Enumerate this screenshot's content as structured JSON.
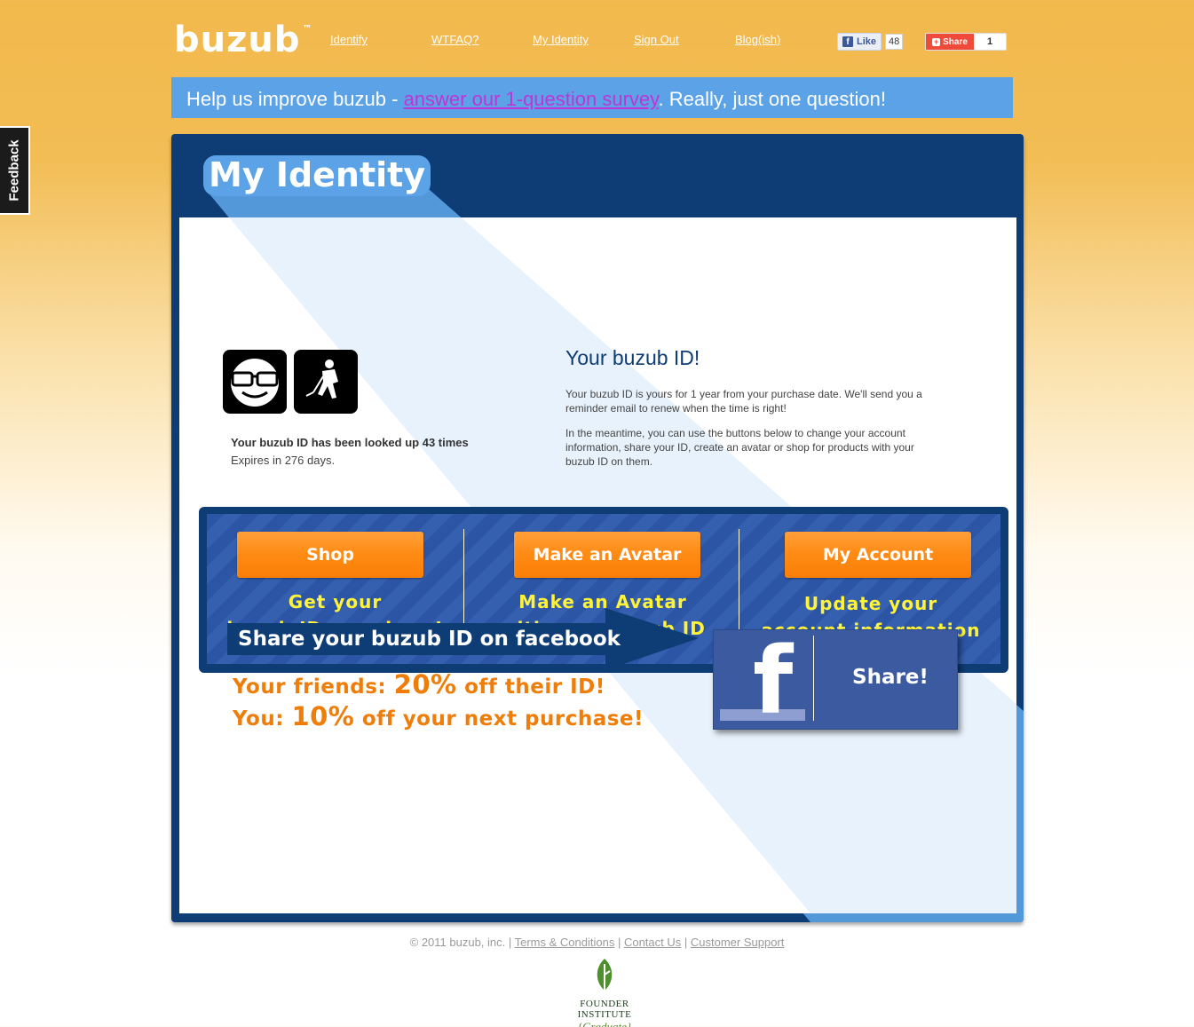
{
  "header": {
    "logo": "buzub",
    "logo_tm": "™",
    "nav": [
      "Identify",
      "WTFAQ?",
      "My Identity",
      "Sign Out",
      "Blog(ish)"
    ],
    "fb_like_label": "Like",
    "fb_like_count": "48",
    "share_label": "Share",
    "share_count": "1"
  },
  "survey": {
    "prefix": "Help us improve buzub - ",
    "link": "answer our 1-question survey",
    "suffix": ". Really, just one question!"
  },
  "feedback_tab": "Feedback",
  "page_title": "My Identity",
  "identity": {
    "lookups": "Your buzub ID has been looked up 43 times",
    "expires": "Expires in 276 days."
  },
  "buzub_id_info": {
    "title": "Your buzub ID!",
    "p1": "Your buzub ID is yours for 1 year from your purchase date. We'll send you a reminder email to renew when the time is right!",
    "p2": "In the meantime, you can use the buttons below to change your account information, share your ID, create an avatar or shop for products with your buzub ID on them."
  },
  "actions": [
    {
      "button": "Shop",
      "line1": "Get your",
      "line2": "buzub ID gear here!"
    },
    {
      "button": "Make an Avatar",
      "line1": "Make an Avatar",
      "line2": "with your buzub ID"
    },
    {
      "button": "My Account",
      "line1": "Update your",
      "line2": "account information"
    }
  ],
  "share": {
    "banner": "Share your buzub ID on facebook",
    "friends_prefix": "Your friends: ",
    "friends_pct": "20%",
    "friends_suffix": " off their ID!",
    "you_prefix": "You: ",
    "you_pct": "10%",
    "you_suffix": " off your next purchase!",
    "fb_button": "Share!"
  },
  "footer": {
    "copyright": "© 2011 buzub, inc. | ",
    "links": [
      "Terms & Conditions",
      "Contact Us",
      "Customer Support"
    ],
    "sep": " | ",
    "badge_name": "FOUNDER INSTITUTE",
    "badge_sub": "{Graduate}"
  },
  "colors": {
    "navy": "#0e3c75",
    "accent_blue": "#5ba3e6",
    "orange": "#ff8c16",
    "yellow_text": "#fff33a",
    "facebook": "#3b5aa0"
  }
}
